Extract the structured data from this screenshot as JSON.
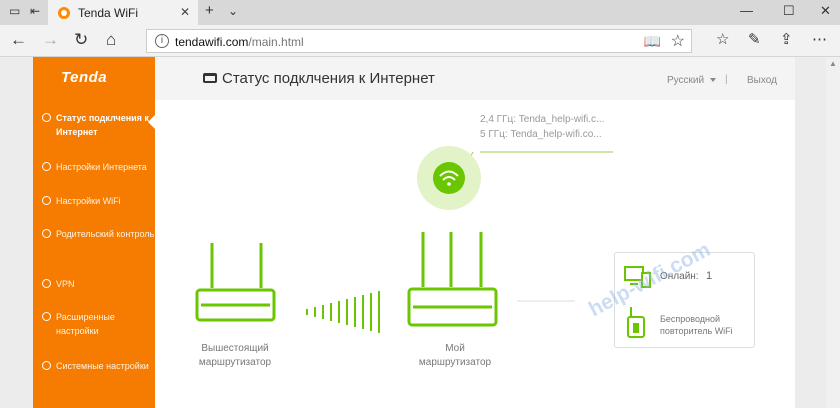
{
  "browser": {
    "tab_title": "Tenda WiFi",
    "url_domain": "tendawifi.com",
    "url_path": "/main.html"
  },
  "sidebar": {
    "brand": "Tenda",
    "items": [
      {
        "label": "Статус подклчения к Интернет",
        "active": true
      },
      {
        "label": "Настройки Интернета"
      },
      {
        "label": "Настройки WiFi"
      },
      {
        "label": "Родительский контроль"
      },
      {
        "label": "VPN"
      },
      {
        "label": "Расширенные настройки"
      },
      {
        "label": "Системные настройки"
      }
    ]
  },
  "header": {
    "title": "Статус подклчения к Интернет",
    "language": "Русский",
    "separator": "|",
    "logout": "Выход"
  },
  "status": {
    "ssid_24": "2,4 ГГц: Tenda_help-wifi.c...",
    "ssid_5": "5 ГГц: Tenda_help-wifi.co...",
    "upstream_label": "Вышестоящий маршрутизатор",
    "my_router_label": "Мой маршрутизатор",
    "online_label": "Онлайн:",
    "online_count": "1",
    "repeater_label": "Беспроводной повторитель WiFi"
  },
  "watermark": "help-wifi.com",
  "colors": {
    "accent": "#f57c00",
    "green": "#6ac600",
    "green_light": "#e3f3c8"
  }
}
